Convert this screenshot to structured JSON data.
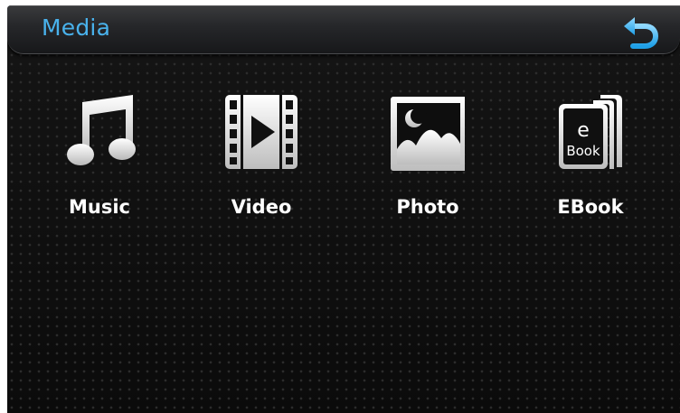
{
  "header": {
    "title": "Media",
    "back_icon": "back-arrow-icon",
    "title_color": "#49b2ec"
  },
  "tiles": [
    {
      "label": "Music",
      "icon": "music-note-icon"
    },
    {
      "label": "Video",
      "icon": "film-play-icon"
    },
    {
      "label": "Photo",
      "icon": "photo-landscape-icon"
    },
    {
      "label": "EBook",
      "icon": "ebook-icon",
      "icon_text_top": "e",
      "icon_text_bottom": "Book"
    }
  ]
}
